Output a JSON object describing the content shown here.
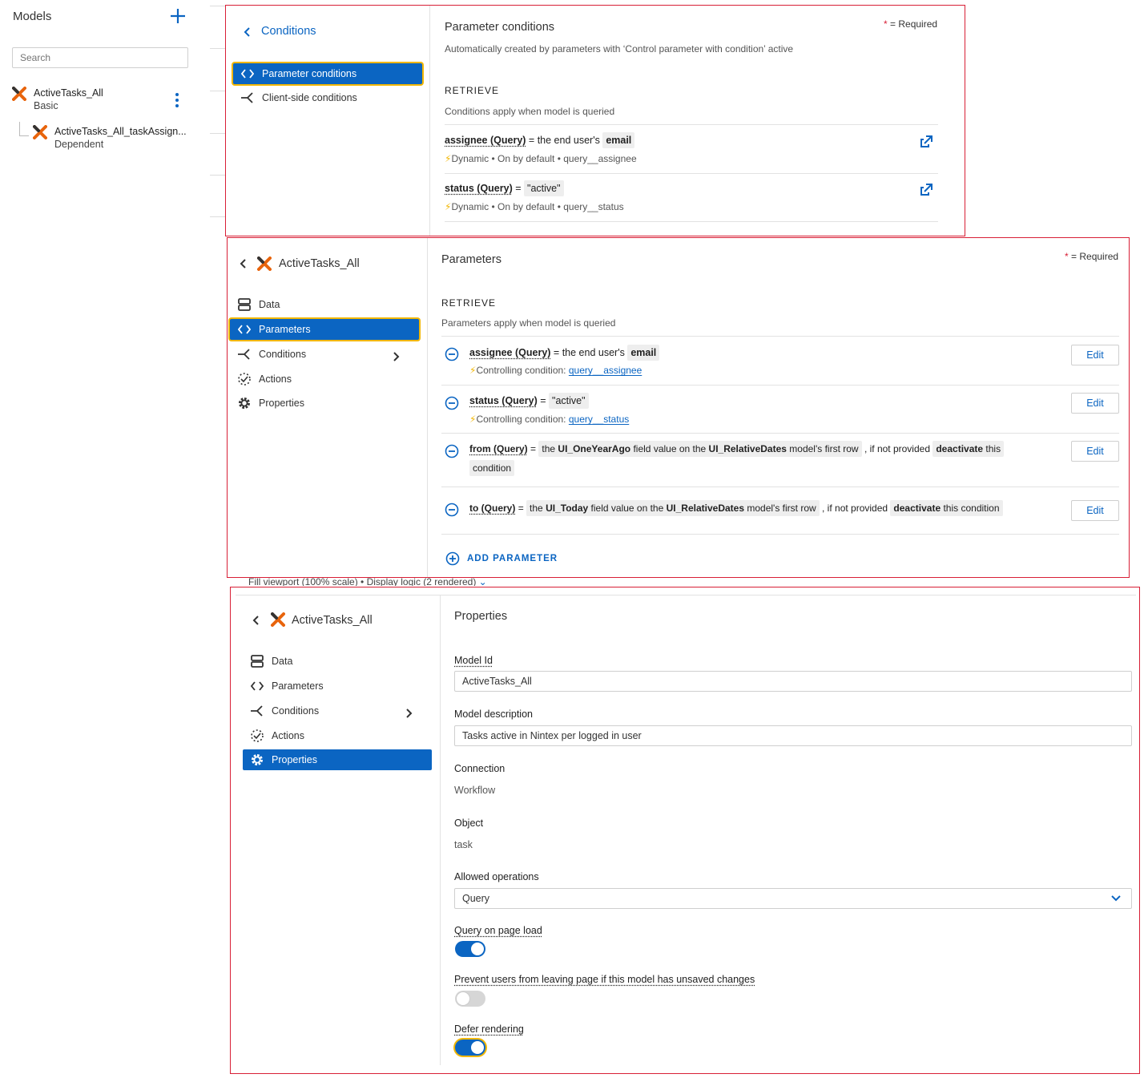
{
  "models_panel": {
    "title": "Models",
    "search_placeholder": "Search",
    "items": [
      {
        "name": "ActiveTasks_All",
        "type": "Basic"
      },
      {
        "name": "ActiveTasks_All_taskAssign...",
        "type": "Dependent"
      }
    ]
  },
  "conditions_panel": {
    "back_label": "Conditions",
    "nav": [
      {
        "label": "Parameter conditions",
        "active": true
      },
      {
        "label": "Client-side conditions",
        "active": false
      }
    ],
    "title": "Parameter conditions",
    "required_note": "= Required",
    "description": "Automatically created by parameters with ‘Control parameter with condition’ active",
    "section": "RETRIEVE",
    "section_sub": "Conditions apply when model is queried",
    "conditions": [
      {
        "field": "assignee (Query)",
        "op": "= the end user's",
        "value": "email",
        "meta": "Dynamic • On by default • query__assignee"
      },
      {
        "field": "status (Query)",
        "op": "=",
        "value": "\"active\"",
        "meta": "Dynamic • On by default • query__status"
      }
    ]
  },
  "parameters_panel": {
    "model_name": "ActiveTasks_All",
    "nav": [
      {
        "label": "Data",
        "icon": "database-icon"
      },
      {
        "label": "Parameters",
        "icon": "code-icon"
      },
      {
        "label": "Conditions",
        "icon": "branch-icon"
      },
      {
        "label": "Actions",
        "icon": "actions-icon"
      },
      {
        "label": "Properties",
        "icon": "gear-icon"
      }
    ],
    "title": "Parameters",
    "required_note": "= Required",
    "section": "RETRIEVE",
    "section_sub": "Parameters apply when model is queried",
    "params": [
      {
        "field": "assignee (Query)",
        "op": "= the end user's",
        "value": "email",
        "controlling_label": "Controlling condition:",
        "controlling": "query__assignee"
      },
      {
        "field": "status (Query)",
        "op": "=",
        "value": "\"active\"",
        "controlling_label": "Controlling condition:",
        "controlling": "query__status"
      },
      {
        "field": "from (Query)",
        "op": "=",
        "pre": "the",
        "b1": "UI_OneYearAgo",
        "mid1": "field value on the",
        "b2": "UI_RelativeDates",
        "mid2": "model's first row",
        "fallback": ", if not provided",
        "act": "deactivate",
        "act_rest1": "this",
        "act_rest2": "condition"
      },
      {
        "field": "to (Query)",
        "op": "=",
        "pre": "the",
        "b1": "UI_Today",
        "mid1": "field value on the",
        "b2": "UI_RelativeDates",
        "mid2": "model's first row",
        "fallback": ", if not provided",
        "act": "deactivate",
        "act_rest1": "this condition"
      }
    ],
    "edit_label": "Edit",
    "add_label": "ADD PARAMETER"
  },
  "behind_text": "Fill viewport (100% scale) • Display logic (2 rendered)",
  "properties_panel": {
    "model_name": "ActiveTasks_All",
    "nav": [
      {
        "label": "Data"
      },
      {
        "label": "Parameters"
      },
      {
        "label": "Conditions"
      },
      {
        "label": "Actions"
      },
      {
        "label": "Properties"
      }
    ],
    "title": "Properties",
    "model_id_label": "Model Id",
    "model_id": "ActiveTasks_All",
    "model_desc_label": "Model description",
    "model_desc": "Tasks active in Nintex per logged in user",
    "connection_label": "Connection",
    "connection": "Workflow",
    "object_label": "Object",
    "object": "task",
    "allowed_ops_label": "Allowed operations",
    "allowed_ops": "Query",
    "query_on_load_label": "Query on page load",
    "query_on_load": true,
    "prevent_leave_label": "Prevent users from leaving page if this model has unsaved changes",
    "prevent_leave": false,
    "defer_label": "Defer rendering",
    "defer": true
  },
  "colors": {
    "accent": "#0b65c2",
    "highlight": "#f2b705",
    "frame": "#d81f36",
    "logo_orange": "#e8640c"
  }
}
